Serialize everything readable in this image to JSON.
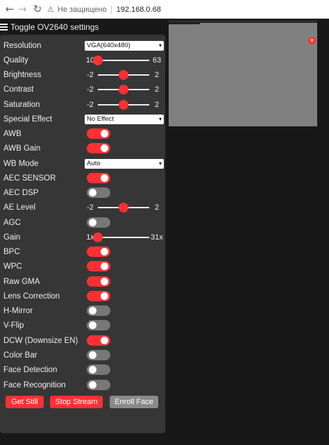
{
  "browser": {
    "back_icon": "←",
    "forward_icon": "→",
    "reload_icon": "↻",
    "warning_icon": "⚠",
    "security_label": "Не защищено",
    "url": "192.168.0.68"
  },
  "header": {
    "toggle_label": "Toggle OV2640 settings"
  },
  "controls": {
    "resolution": {
      "label": "Resolution",
      "value": "VGA(640x480)"
    },
    "quality": {
      "label": "Quality",
      "min": "10",
      "max": "63",
      "value": 10
    },
    "brightness": {
      "label": "Brightness",
      "min": "-2",
      "max": "2",
      "value": 0
    },
    "contrast": {
      "label": "Contrast",
      "min": "-2",
      "max": "2",
      "value": 0
    },
    "saturation": {
      "label": "Saturation",
      "min": "-2",
      "max": "2",
      "value": 0
    },
    "special_effect": {
      "label": "Special Effect",
      "value": "No Effect"
    },
    "awb": {
      "label": "AWB",
      "on": true
    },
    "awb_gain": {
      "label": "AWB Gain",
      "on": true
    },
    "wb_mode": {
      "label": "WB Mode",
      "value": "Auto"
    },
    "aec_sensor": {
      "label": "AEC SENSOR",
      "on": true
    },
    "aec_dsp": {
      "label": "AEC DSP",
      "on": false
    },
    "ae_level": {
      "label": "AE Level",
      "min": "-2",
      "max": "2",
      "value": 0
    },
    "agc": {
      "label": "AGC",
      "on": false
    },
    "gain": {
      "label": "Gain",
      "min": "1x",
      "max": "31x",
      "value": 1
    },
    "bpc": {
      "label": "BPC",
      "on": true
    },
    "wpc": {
      "label": "WPC",
      "on": true
    },
    "raw_gma": {
      "label": "Raw GMA",
      "on": true
    },
    "lens_correction": {
      "label": "Lens Correction",
      "on": true
    },
    "hmirror": {
      "label": "H-Mirror",
      "on": false
    },
    "vflip": {
      "label": "V-Flip",
      "on": false
    },
    "dcw": {
      "label": "DCW (Downsize EN)",
      "on": true
    },
    "colorbar": {
      "label": "Color Bar",
      "on": false
    },
    "face_detection": {
      "label": "Face Detection",
      "on": false
    },
    "face_recognition": {
      "label": "Face Recognition",
      "on": false
    }
  },
  "buttons": {
    "get_still": "Get Still",
    "stop_stream": "Stop Stream",
    "enroll_face": "Enroll Face"
  },
  "stream": {
    "close_icon": "✕"
  },
  "colors": {
    "accent": "#ff3034",
    "panel": "#363636",
    "background": "#181818",
    "disabled": "#8a8a8a"
  }
}
